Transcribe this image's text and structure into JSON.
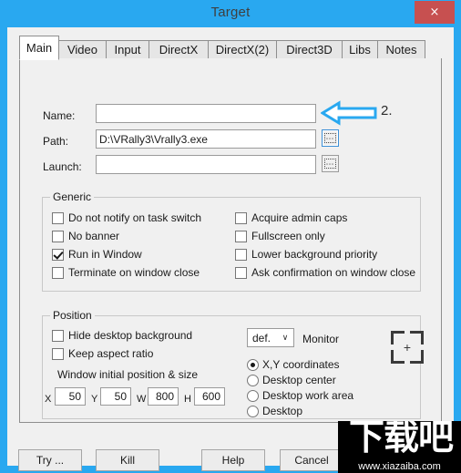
{
  "window": {
    "title": "Target",
    "close_label": "×",
    "accent_color": "#29a8f0",
    "close_color": "#c75050"
  },
  "tabs": [
    {
      "label": "Main",
      "active": true
    },
    {
      "label": "Video",
      "active": false
    },
    {
      "label": "Input",
      "active": false
    },
    {
      "label": "DirectX",
      "active": false
    },
    {
      "label": "DirectX(2)",
      "active": false
    },
    {
      "label": "Direct3D",
      "active": false
    },
    {
      "label": "Libs",
      "active": false
    },
    {
      "label": "Notes",
      "active": false
    }
  ],
  "fields": {
    "name": {
      "label": "Name:",
      "value": "",
      "placeholder": ""
    },
    "path": {
      "label": "Path:",
      "value": "D:\\VRally3\\Vrally3.exe",
      "placeholder": ""
    },
    "launch": {
      "label": "Launch:",
      "value": "",
      "placeholder": ""
    },
    "browse_label": "..."
  },
  "generic": {
    "title": "Generic",
    "left": [
      {
        "label": "Do not notify on task switch",
        "checked": false
      },
      {
        "label": "No banner",
        "checked": false
      },
      {
        "label": "Run in Window",
        "checked": true
      },
      {
        "label": "Terminate on window close",
        "checked": false
      }
    ],
    "right": [
      {
        "label": "Acquire admin caps",
        "checked": false
      },
      {
        "label": "Fullscreen only",
        "checked": false
      },
      {
        "label": "Lower background priority",
        "checked": false
      },
      {
        "label": "Ask confirmation on window close",
        "checked": false
      }
    ]
  },
  "position": {
    "title": "Position",
    "checkboxes": [
      {
        "label": "Hide desktop background",
        "checked": false
      },
      {
        "label": "Keep aspect ratio",
        "checked": false
      }
    ],
    "size_caption": "Window initial position & size",
    "coords": [
      {
        "label": "X",
        "value": "50"
      },
      {
        "label": "Y",
        "value": "50"
      },
      {
        "label": "W",
        "value": "800"
      },
      {
        "label": "H",
        "value": "600"
      }
    ],
    "monitor": {
      "selected": "def.",
      "label": "Monitor",
      "arrow": "∨",
      "options": [
        "def."
      ]
    },
    "picker_icon": "+",
    "modes": [
      {
        "label": "X,Y coordinates",
        "selected": true
      },
      {
        "label": "Desktop center",
        "selected": false
      },
      {
        "label": "Desktop work area",
        "selected": false
      },
      {
        "label": "Desktop",
        "selected": false
      }
    ]
  },
  "buttons": [
    {
      "label": "Try ..."
    },
    {
      "label": "Kill"
    },
    {
      "label": "Help"
    },
    {
      "label": "Cancel"
    }
  ],
  "annotation": {
    "number": "2.",
    "arrow_color": "#29a8f0"
  },
  "watermark": {
    "text": "下载吧",
    "url": "www.xiazaiba.com"
  }
}
